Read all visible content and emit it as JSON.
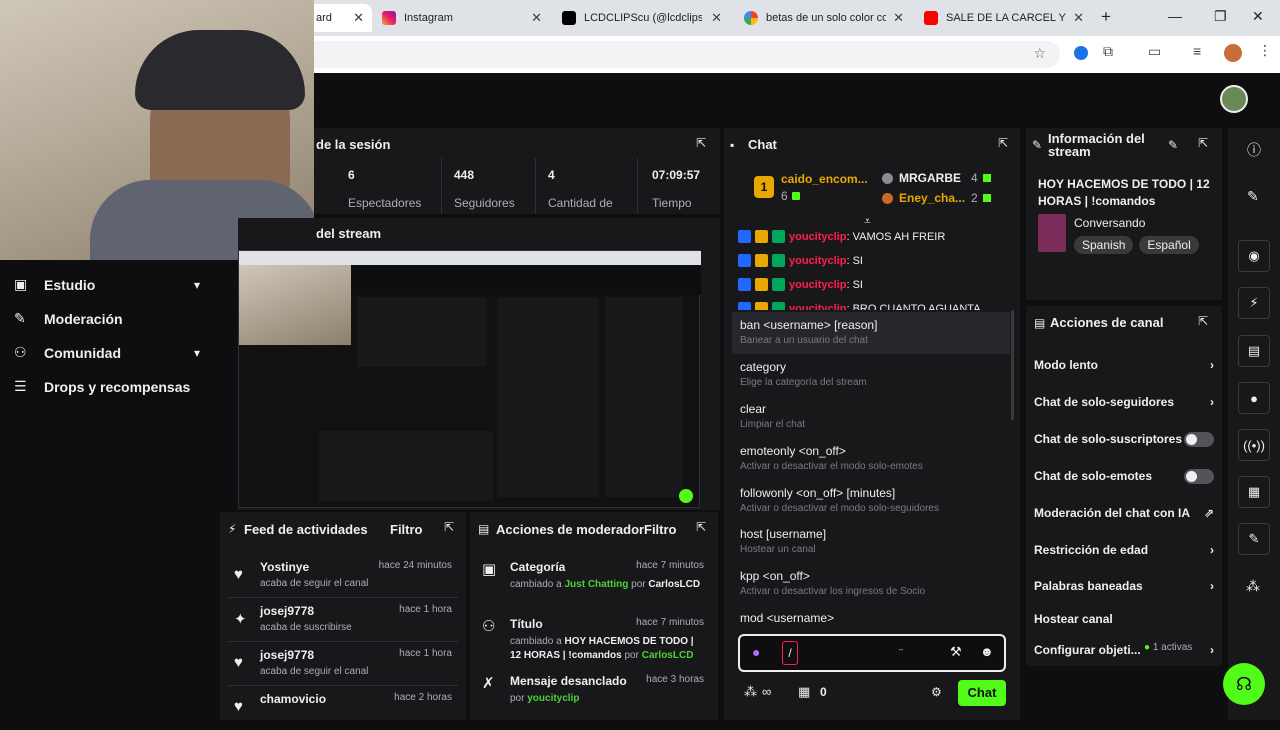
{
  "browser": {
    "tabs": [
      {
        "title": "ard"
      },
      {
        "title": "Instagram"
      },
      {
        "title": "LCDCLIPScu (@lcdclips) | Ti"
      },
      {
        "title": "betas de un solo color com"
      },
      {
        "title": "SALE DE LA CARCEL Y GAN"
      }
    ],
    "new_tab": "+"
  },
  "sidebar": {
    "items": [
      {
        "label": "Estudio",
        "icon": "video-icon",
        "chevron": true
      },
      {
        "label": "Moderación",
        "icon": "wrench-icon",
        "chevron": false
      },
      {
        "label": "Comunidad",
        "icon": "people-icon",
        "chevron": true
      },
      {
        "label": "Drops y recompensas",
        "icon": "drops-icon",
        "chevron": false
      }
    ]
  },
  "session": {
    "title": "de la sesión",
    "stats": [
      {
        "value": "6",
        "label": "Espectadores"
      },
      {
        "value": "448",
        "label": "Seguidores"
      },
      {
        "value": "4",
        "label": "Cantidad de"
      },
      {
        "value": "07:09:57",
        "label": "Tiempo"
      }
    ]
  },
  "preview": {
    "title": "del stream"
  },
  "feed": {
    "title": "Feed de actividades",
    "filter": "Filtro",
    "rows": [
      {
        "name": "Yostinye",
        "sub": "acaba de seguir el canal",
        "time": "hace 24 minutos",
        "icon": "heart-icon"
      },
      {
        "name": "josej9778",
        "sub": "acaba de suscribirse",
        "time": "hace 1 hora",
        "icon": "star-icon"
      },
      {
        "name": "josej9778",
        "sub": "acaba de seguir el canal",
        "time": "hace 1 hora",
        "icon": "heart-icon"
      },
      {
        "name": "chamovicio",
        "sub": "",
        "time": "hace 2 horas",
        "icon": "heart-icon"
      }
    ]
  },
  "modactions": {
    "title": "Acciones de moderador",
    "filter": "Filtro",
    "rows": [
      {
        "name": "Categoría",
        "time": "hace 7 minutos",
        "pre": "cambiado a ",
        "value": "Just Chatting",
        "by": " por ",
        "user": "CarlosLCD",
        "icon": "category-icon"
      },
      {
        "name": "Título",
        "time": "hace 7 minutos",
        "pre": "cambiado a ",
        "value": "HOY HACEMOS DE TODO | 12 HORAS | !comandos",
        "by": " por ",
        "user": "CarlosLCD",
        "icon": "title-icon"
      },
      {
        "name": "Mensaje desanclado",
        "time": "hace 3 horas",
        "pre": "",
        "value": "",
        "by": "por ",
        "user": "youcityclip",
        "icon": "unpin-icon"
      }
    ]
  },
  "chat": {
    "title": "Chat",
    "leaderboard": {
      "first": {
        "rank": "1",
        "name": "caido_encom...",
        "points": "6"
      },
      "second": {
        "rank": "2",
        "name": "MRGARBE",
        "points": "4"
      },
      "third": {
        "rank": "3",
        "name": "Eney_cha...",
        "points": "2"
      }
    },
    "messages": [
      {
        "user": "youcityclip",
        "text": ": VAMOS AH FREIR"
      },
      {
        "user": "youcityclip",
        "text": ": SI"
      },
      {
        "user": "youcityclip",
        "text": ": SI"
      },
      {
        "user": "youcityclip",
        "text": ": BRO CUANTO AGUANTA"
      }
    ],
    "commands": [
      {
        "cmd": "ban <username> [reason]",
        "desc": "Banear a un usuario del chat"
      },
      {
        "cmd": "category",
        "desc": "Elige la categoría del stream"
      },
      {
        "cmd": "clear",
        "desc": "Limpiar el chat"
      },
      {
        "cmd": "emoteonly <on_off>",
        "desc": "Activar o desactivar el modo solo-emotes"
      },
      {
        "cmd": "followonly <on_off> [minutes]",
        "desc": "Activar o desactivar el modo solo-seguidores"
      },
      {
        "cmd": "host [username]",
        "desc": "Hostear un canal"
      },
      {
        "cmd": "kpp <on_off>",
        "desc": "Activar o desactivar los ingresos de Socio"
      },
      {
        "cmd": "mod <username>",
        "desc": ""
      }
    ],
    "input_value": "/",
    "points": "0",
    "send_label": "Chat"
  },
  "streaminfo": {
    "title": "Información del stream",
    "stream_title": "HOY HACEMOS DE TODO | 12 HORAS | !comandos",
    "category": "Conversando",
    "tags": [
      "Spanish",
      "Español"
    ]
  },
  "channelactions": {
    "title": "Acciones de canal",
    "items": [
      {
        "label": "Modo lento",
        "kind": "chevron"
      },
      {
        "label": "Chat de solo-seguidores",
        "kind": "chevron"
      },
      {
        "label": "Chat de solo-suscriptores",
        "kind": "toggle"
      },
      {
        "label": "Chat de solo-emotes",
        "kind": "toggle"
      },
      {
        "label": "Moderación del chat con IA",
        "kind": "external"
      },
      {
        "label": "Restricción de edad",
        "kind": "chevron"
      },
      {
        "label": "Palabras baneadas",
        "kind": "chevron"
      },
      {
        "label": "Hostear canal",
        "kind": "none"
      },
      {
        "label": "Configurar objeti...",
        "kind": "chevron"
      }
    ],
    "active_goals": "1 activas"
  },
  "colors": {
    "accent": "#53fc18",
    "brand_purple": "#9147ff",
    "badge_yellow": "#e9a800"
  }
}
